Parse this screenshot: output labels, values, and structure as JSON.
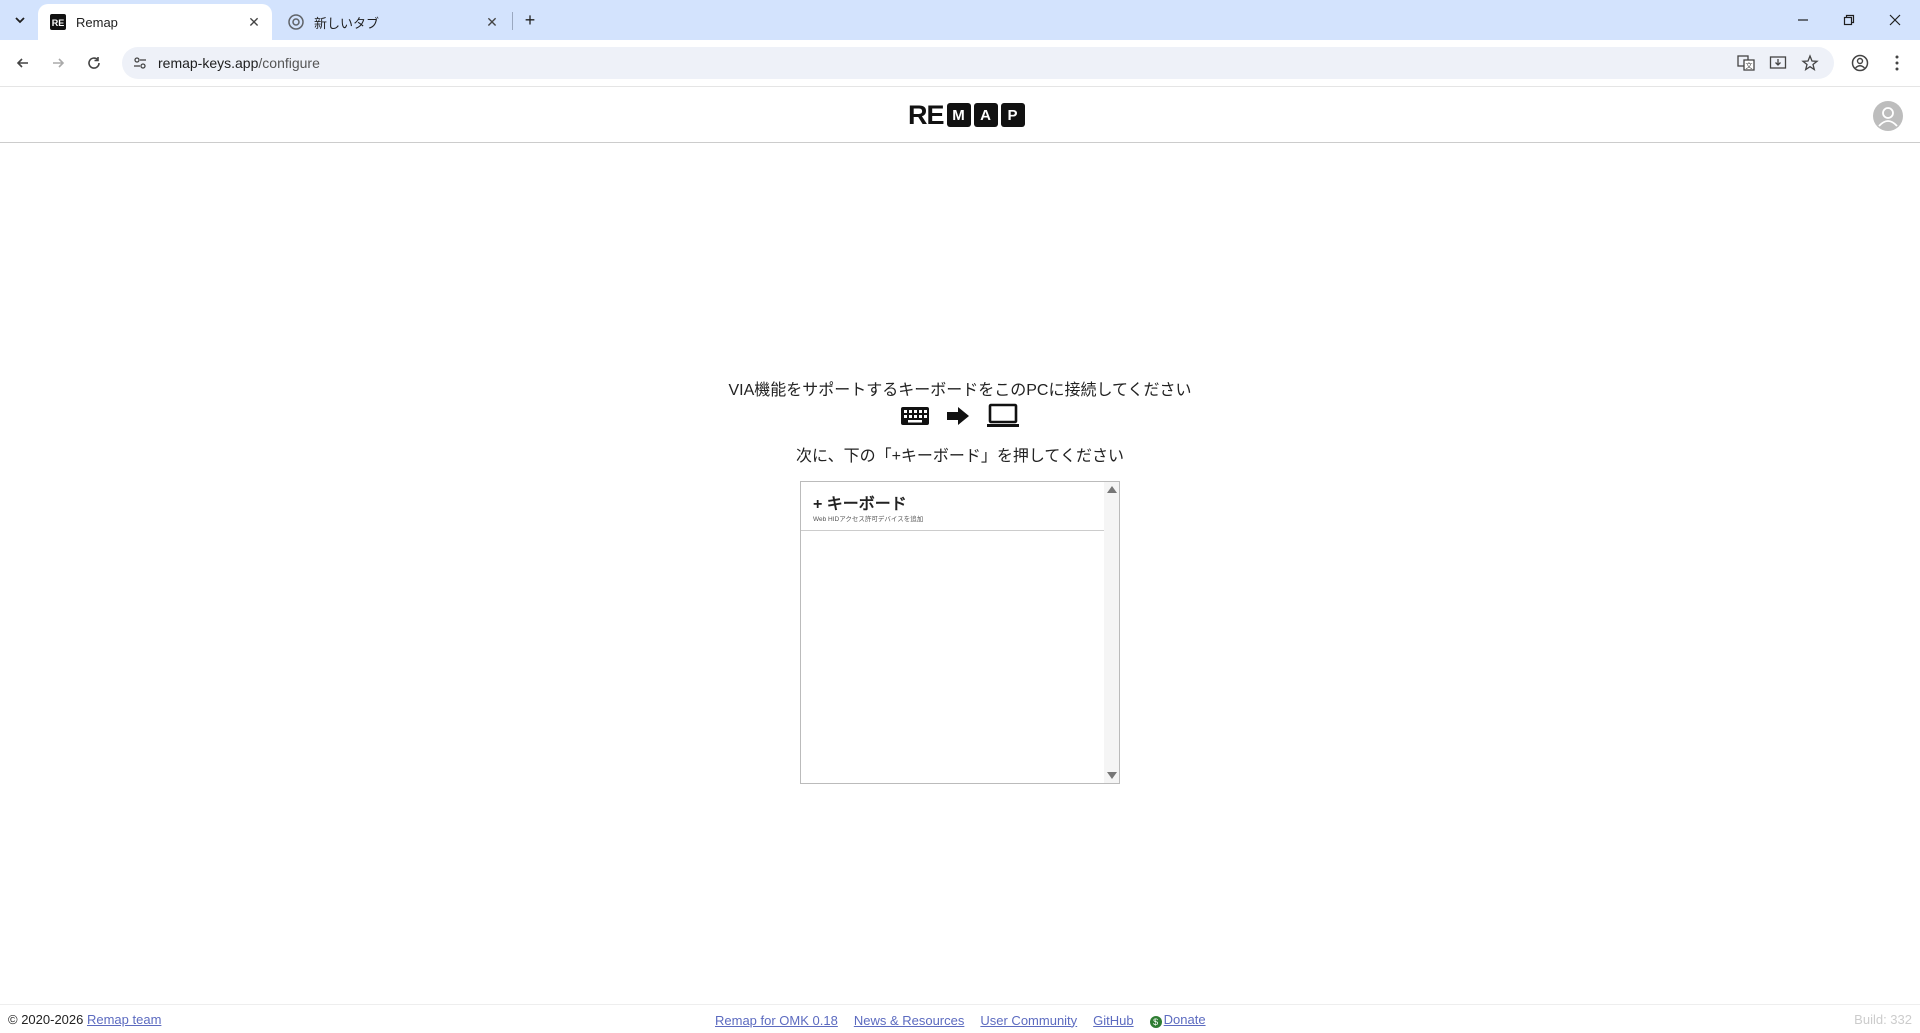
{
  "browser": {
    "tabs": [
      {
        "title": "Remap",
        "active": true,
        "favicon": "remap-favicon"
      },
      {
        "title": "新しいタブ",
        "active": false,
        "favicon": "chrome-icon"
      }
    ],
    "url": {
      "host": "remap-keys.app",
      "path": "/configure"
    }
  },
  "app": {
    "logo": {
      "prefix": "RE",
      "boxes": [
        "M",
        "A",
        "P"
      ]
    },
    "instruction_connect": "VIA機能をサポートするキーボードをこのPCに接続してください",
    "instruction_press": "次に、下の「+キーボード」を押してください",
    "keyboard_list": {
      "add_label": "+ キーボード",
      "add_sublabel": "Web HIDアクセス許可デバイスを追加"
    }
  },
  "footer": {
    "copyright": "© 2020-2026",
    "team_link": "Remap team",
    "links": [
      "Remap for OMK 0.18",
      "News & Resources",
      "User Community",
      "GitHub"
    ],
    "donate": "Donate",
    "build": "Build: 332"
  },
  "colors": {
    "tabstrip": "#d3e3fd",
    "link": "#5c6bc0",
    "donate": "#2e7d32"
  }
}
